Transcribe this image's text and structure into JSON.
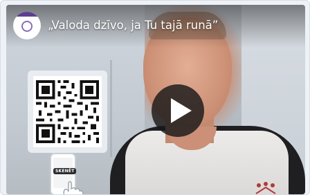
{
  "video": {
    "title": "„Valoda dzīvo, ja Tu tajā runā”",
    "channel_avatar_icon": "channel-logo",
    "play_icon": "play-icon"
  },
  "qr_panel": {
    "qr_icon": "qr-code-icon",
    "scan_label": "SKENĒT",
    "phone_icon": "phone-icon"
  },
  "colors": {
    "brand_purple": "#5d3f8f",
    "play_button_bg": "#18181a",
    "title_text": "#ffffff"
  }
}
